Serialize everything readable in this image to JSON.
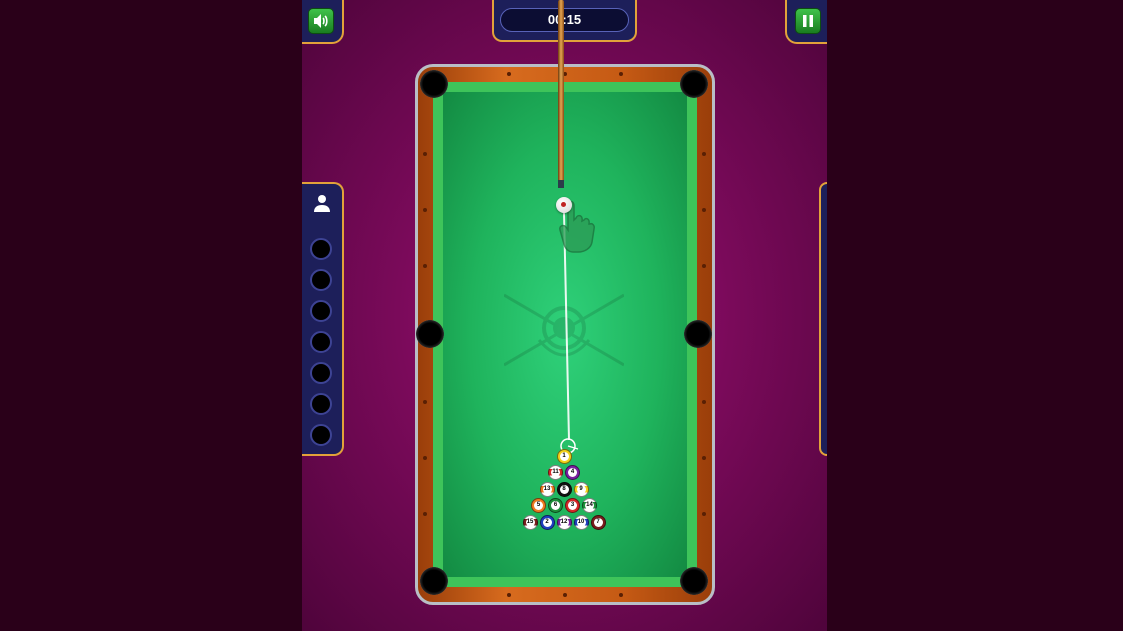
{
  "hud": {
    "timer": "00:15"
  },
  "icons": {
    "sound": "speaker-icon",
    "pause": "pause-icon",
    "player": "person-icon",
    "hand": "hand-icon"
  },
  "colors": {
    "accent_gold": "#e2a23a",
    "panel": "#1d1f5a",
    "button_green": "#2fa23a",
    "felt": "#1fb35c",
    "rail_wood": "#c55a14",
    "background_magenta": "#7a0a5a"
  },
  "balls": [
    {
      "number": "1",
      "color": "#f2d21b",
      "stripe": false
    },
    {
      "number": "11",
      "color": "#d62828",
      "stripe": true
    },
    {
      "number": "4",
      "color": "#7a1fa2",
      "stripe": false
    },
    {
      "number": "13",
      "color": "#ef7b21",
      "stripe": true
    },
    {
      "number": "8",
      "color": "#111111",
      "stripe": false
    },
    {
      "number": "9",
      "color": "#f2d21b",
      "stripe": true
    },
    {
      "number": "5",
      "color": "#ef7b21",
      "stripe": false
    },
    {
      "number": "6",
      "color": "#1d8f3a",
      "stripe": false
    },
    {
      "number": "3",
      "color": "#d62828",
      "stripe": false
    },
    {
      "number": "14",
      "color": "#1d8f3a",
      "stripe": true
    },
    {
      "number": "15",
      "color": "#7a1d1d",
      "stripe": true
    },
    {
      "number": "2",
      "color": "#1f3fbf",
      "stripe": false
    },
    {
      "number": "12",
      "color": "#7a1fa2",
      "stripe": true
    },
    {
      "number": "10",
      "color": "#1f3fbf",
      "stripe": true
    },
    {
      "number": "7",
      "color": "#7a1d1d",
      "stripe": false
    }
  ],
  "pocketed_slots": 7
}
